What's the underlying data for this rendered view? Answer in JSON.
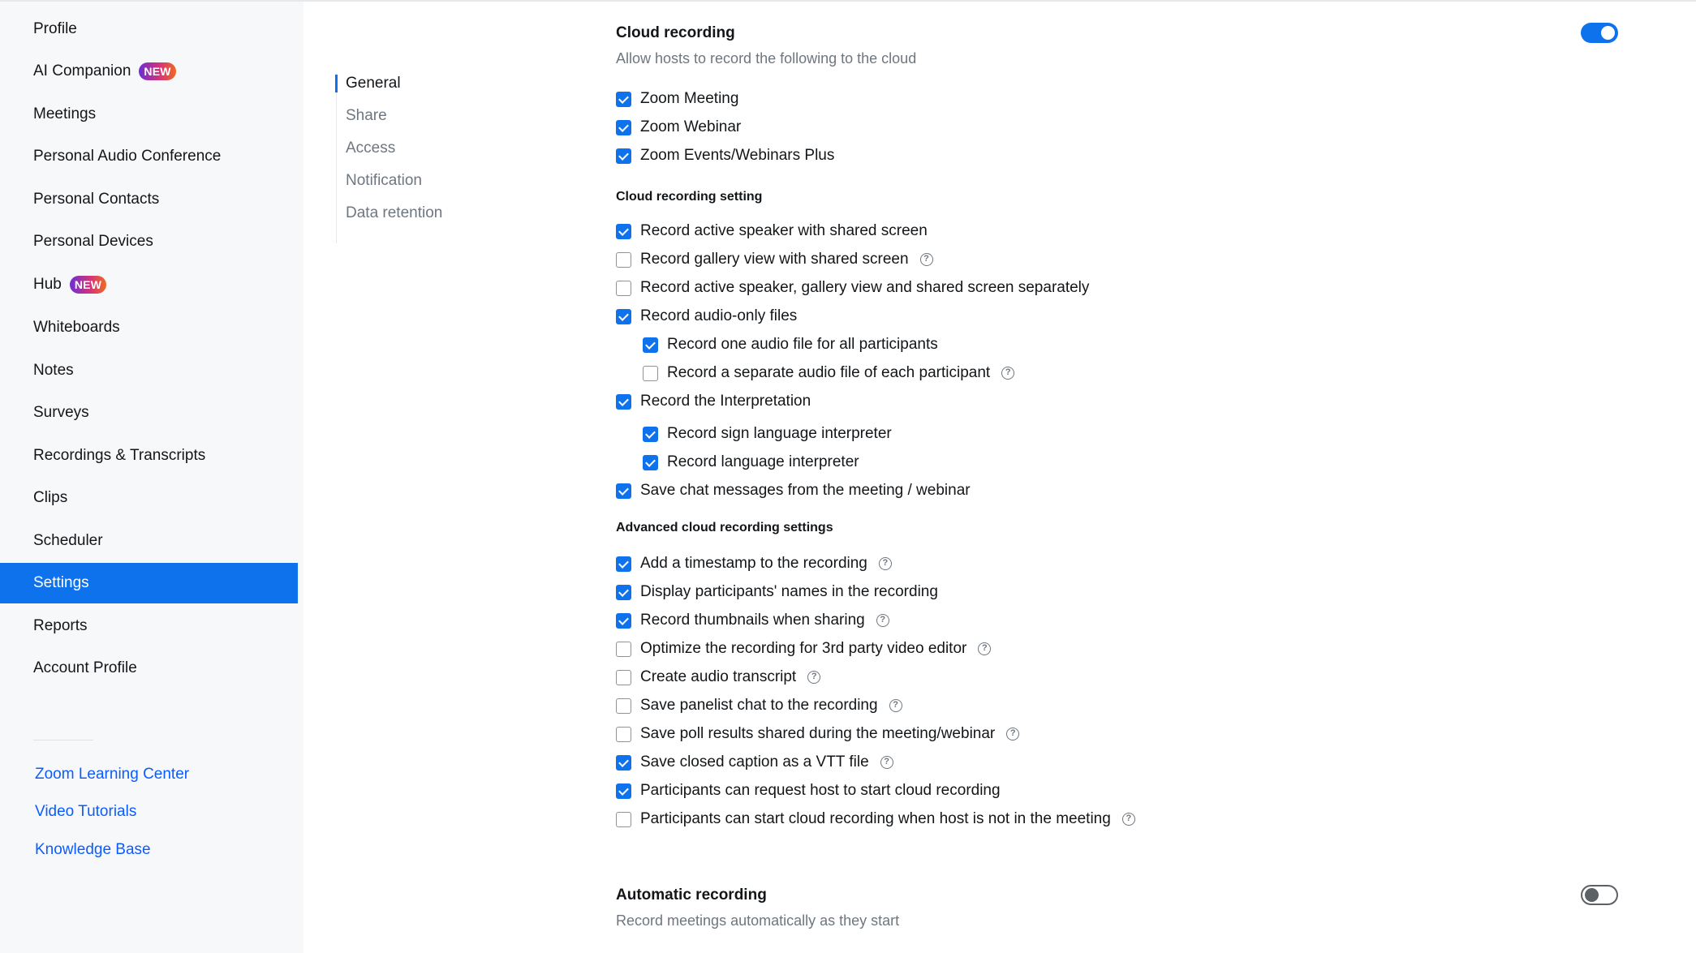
{
  "sidebar": {
    "items": [
      {
        "label": "Profile"
      },
      {
        "label": "AI Companion",
        "badge": "NEW"
      },
      {
        "label": "Meetings"
      },
      {
        "label": "Personal Audio Conference"
      },
      {
        "label": "Personal Contacts"
      },
      {
        "label": "Personal Devices"
      },
      {
        "label": "Hub",
        "badge": "NEW"
      },
      {
        "label": "Whiteboards"
      },
      {
        "label": "Notes"
      },
      {
        "label": "Surveys"
      },
      {
        "label": "Recordings & Transcripts"
      },
      {
        "label": "Clips"
      },
      {
        "label": "Scheduler"
      },
      {
        "label": "Settings",
        "active": true
      },
      {
        "label": "Reports"
      },
      {
        "label": "Account Profile"
      }
    ],
    "help_links": [
      "Zoom Learning Center",
      "Video Tutorials",
      "Knowledge Base"
    ]
  },
  "subnav": {
    "items": [
      "General",
      "Share",
      "Access",
      "Notification",
      "Data retention"
    ],
    "active": "General"
  },
  "cloud_recording": {
    "title": "Cloud recording",
    "description": "Allow hosts to record the following to the cloud",
    "enabled": true,
    "targets": [
      {
        "label": "Zoom Meeting",
        "checked": true
      },
      {
        "label": "Zoom Webinar",
        "checked": true
      },
      {
        "label": "Zoom Events/Webinars Plus",
        "checked": true
      }
    ],
    "setting_heading": "Cloud recording setting",
    "settings": [
      {
        "label": "Record active speaker with shared screen",
        "checked": true
      },
      {
        "label": "Record gallery view with shared screen",
        "checked": false,
        "info": true
      },
      {
        "label": "Record active speaker, gallery view and shared screen separately",
        "checked": false
      },
      {
        "label": "Record audio-only files",
        "checked": true
      },
      {
        "label": "Record one audio file for all participants",
        "checked": true,
        "indent": true
      },
      {
        "label": "Record a separate audio file of each participant",
        "checked": false,
        "indent": true,
        "info": true
      },
      {
        "label": "Record the Interpretation",
        "checked": true
      },
      {
        "label": "Record sign language interpreter",
        "checked": true,
        "indent": true
      },
      {
        "label": "Record language interpreter",
        "checked": true,
        "indent": true
      },
      {
        "label": "Save chat messages from the meeting / webinar",
        "checked": true
      }
    ],
    "advanced_heading": "Advanced cloud recording settings",
    "advanced": [
      {
        "label": "Add a timestamp to the recording",
        "checked": true,
        "info": true
      },
      {
        "label": "Display participants' names in the recording",
        "checked": true
      },
      {
        "label": "Record thumbnails when sharing",
        "checked": true,
        "info": true
      },
      {
        "label": "Optimize the recording for 3rd party video editor",
        "checked": false,
        "info": true
      },
      {
        "label": "Create audio transcript",
        "checked": false,
        "info": true
      },
      {
        "label": "Save panelist chat to the recording",
        "checked": false,
        "info": true
      },
      {
        "label": "Save poll results shared during the meeting/webinar",
        "checked": false,
        "info": true
      },
      {
        "label": "Save closed caption as a VTT file",
        "checked": true,
        "info": true
      },
      {
        "label": "Participants can request host to start cloud recording",
        "checked": true
      },
      {
        "label": "Participants can start cloud recording when host is not in the meeting",
        "checked": false,
        "info": true
      }
    ]
  },
  "automatic_recording": {
    "title": "Automatic recording",
    "description": "Record meetings automatically as they start",
    "enabled": false
  },
  "icons": {
    "info": "?"
  },
  "colors": {
    "accent": "#0e72ed",
    "link": "#0b5cff",
    "muted": "#6e7680"
  }
}
